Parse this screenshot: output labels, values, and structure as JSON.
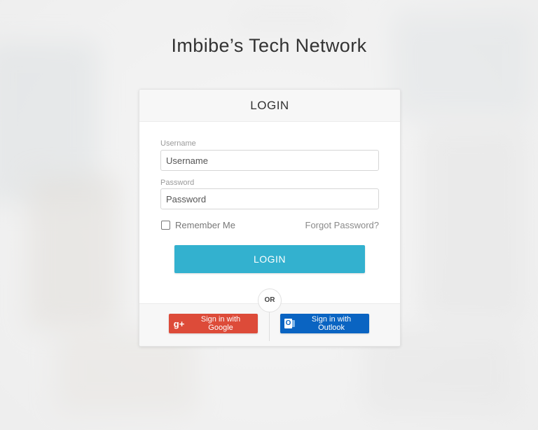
{
  "site_title": "Imbibe’s Tech Network",
  "card": {
    "header_title": "LOGIN",
    "username": {
      "label": "Username",
      "placeholder": "Username",
      "value": ""
    },
    "password": {
      "label": "Password",
      "placeholder": "Password",
      "value": ""
    },
    "remember_label": "Remember Me",
    "forgot_label": "Forgot Password?",
    "login_button": "LOGIN",
    "or_label": "OR",
    "google_button": "Sign in with Google",
    "outlook_button": "Sign in with Outlook"
  },
  "icons": {
    "google": "google-plus-icon",
    "google_glyph": "g+",
    "outlook": "outlook-icon",
    "outlook_glyph": "O"
  },
  "colors": {
    "login_button": "#33b1cf",
    "google_button": "#dd4b39",
    "outlook_button": "#0a64c2"
  }
}
